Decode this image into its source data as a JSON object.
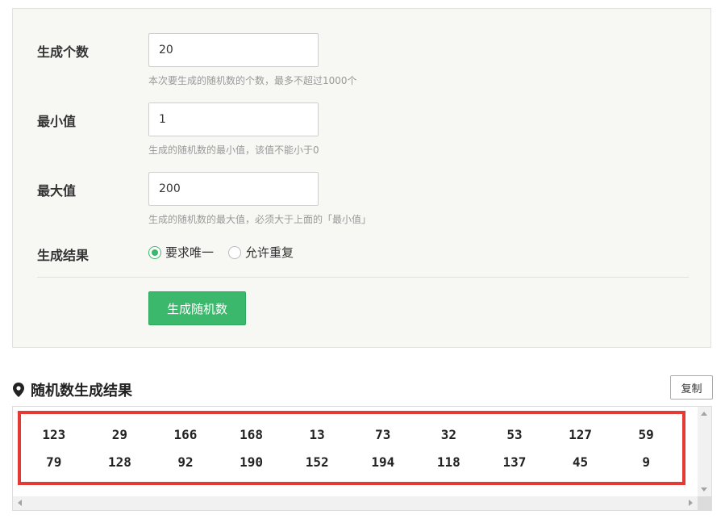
{
  "form": {
    "count": {
      "label": "生成个数",
      "value": "20",
      "hint": "本次要生成的随机数的个数，最多不超过1000个"
    },
    "min": {
      "label": "最小值",
      "value": "1",
      "hint": "生成的随机数的最小值，该值不能小于0"
    },
    "max": {
      "label": "最大值",
      "value": "200",
      "hint": "生成的随机数的最大值，必须大于上面的「最小值」"
    },
    "result_mode": {
      "label": "生成结果",
      "options": [
        {
          "label": "要求唯一",
          "checked": true
        },
        {
          "label": "允许重复",
          "checked": false
        }
      ]
    },
    "generate_button": "生成随机数"
  },
  "results": {
    "title": "随机数生成结果",
    "copy_button": "复制",
    "rows": [
      [
        "123",
        "29",
        "166",
        "168",
        "13",
        "73",
        "32",
        "53",
        "127",
        "59"
      ],
      [
        "79",
        "128",
        "92",
        "190",
        "152",
        "194",
        "118",
        "137",
        "45",
        "9"
      ]
    ]
  },
  "colors": {
    "accent": "#3bb86b",
    "highlight_frame": "#e53935",
    "panel_bg": "#f7f7f4"
  },
  "icons": {
    "section": "map-pin-icon"
  }
}
